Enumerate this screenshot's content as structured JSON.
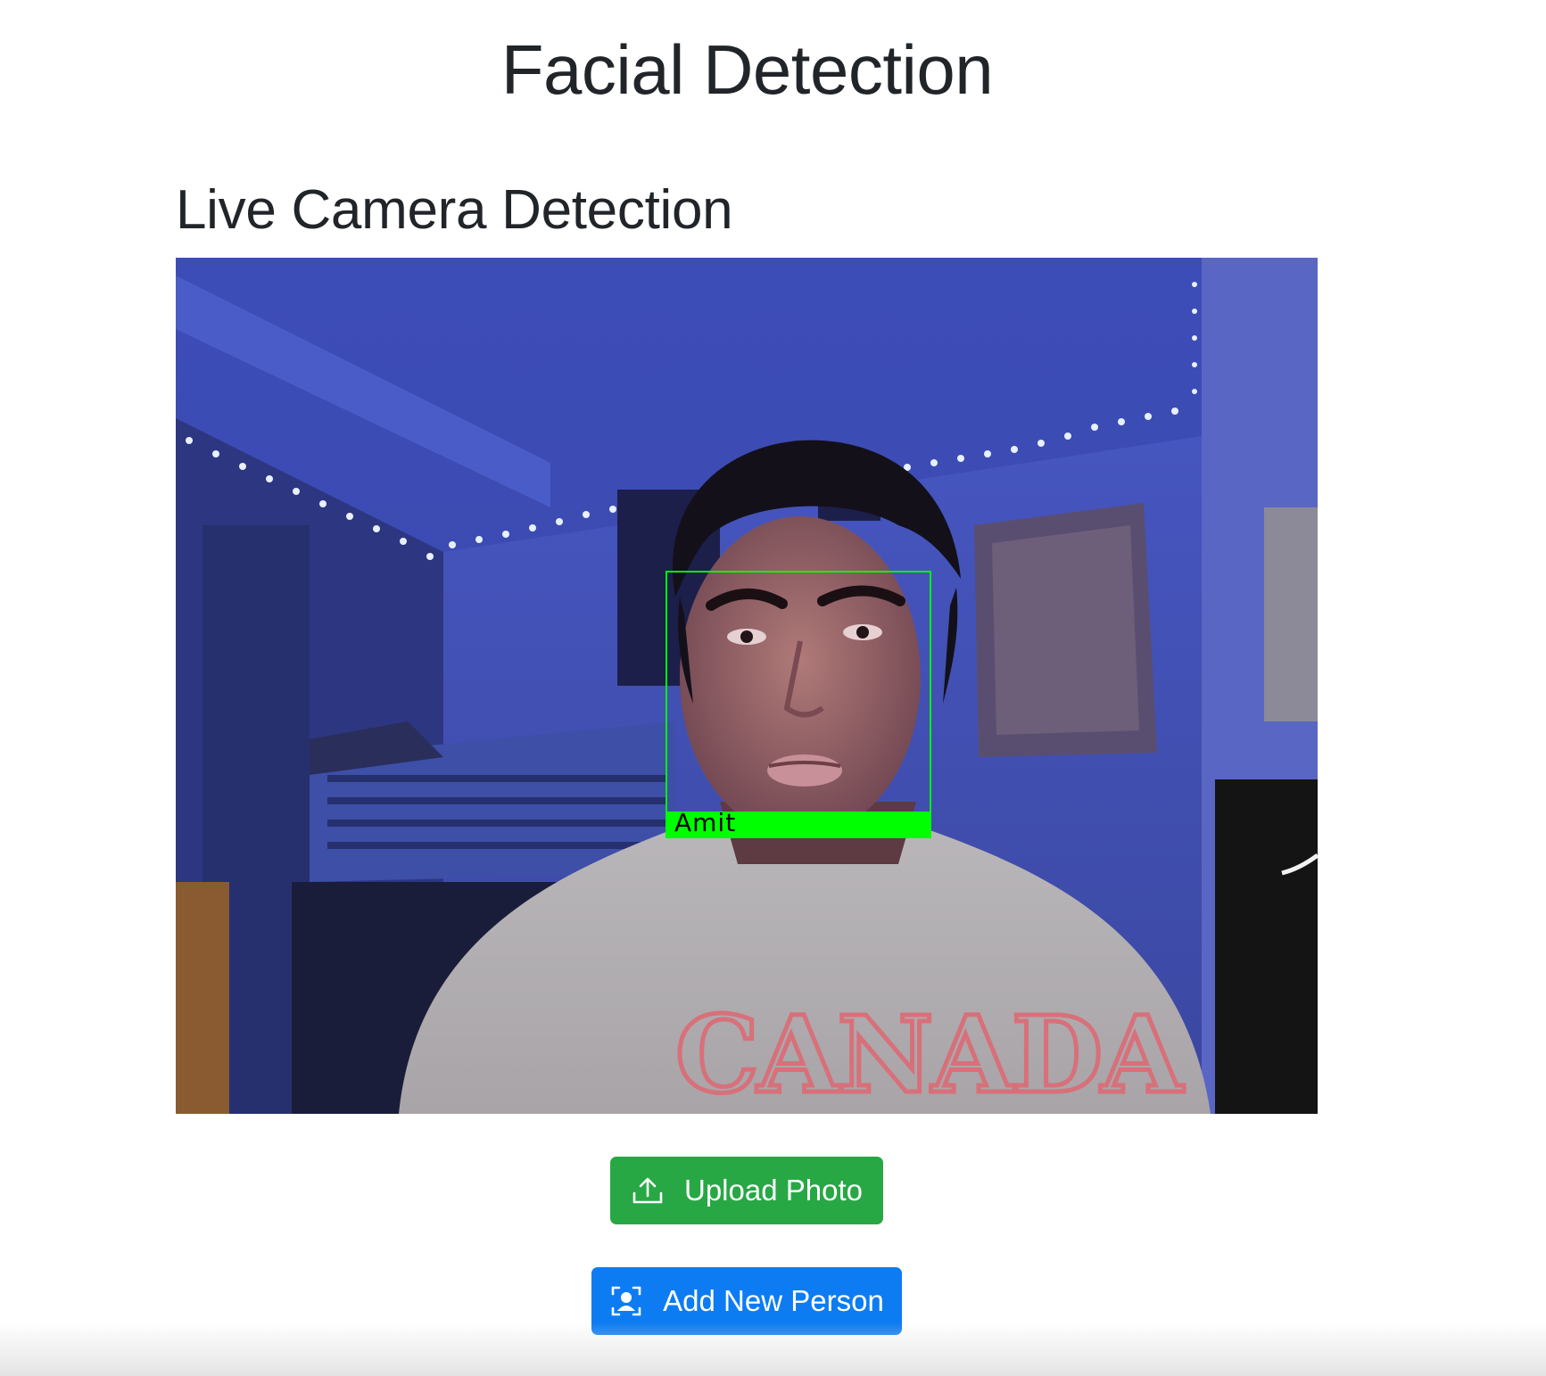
{
  "page": {
    "title": "Facial Detection"
  },
  "live_section": {
    "title": "Live Camera Detection",
    "detection": {
      "label": "Amit",
      "box_color": "#00ff00"
    }
  },
  "actions": {
    "upload": {
      "label": "Upload Photo",
      "icon": "upload-icon",
      "color": "#28a745"
    },
    "add_person": {
      "label": "Add New Person",
      "icon": "person-badge-icon",
      "color": "#0d7cf2"
    }
  }
}
